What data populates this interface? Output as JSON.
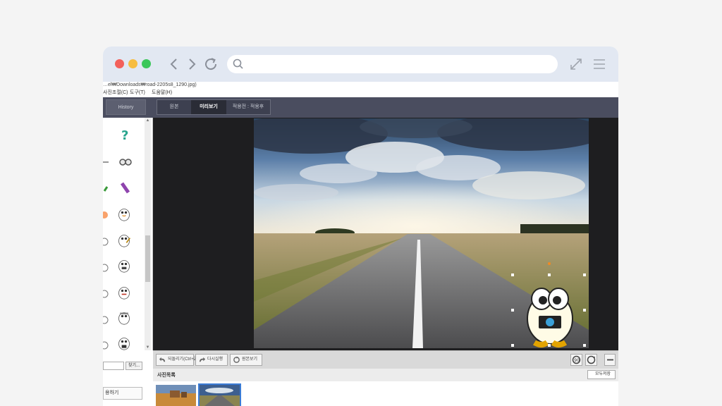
{
  "browser": {
    "url_placeholder": "",
    "url_value": "",
    "colors": {
      "close": "#f3605a",
      "minimize": "#f7bd40",
      "maximize": "#3bc75a",
      "chrome_bg": "#e2e8f2"
    },
    "icons": [
      "back-icon",
      "forward-icon",
      "reload-icon",
      "search-icon",
      "expand-icon",
      "menu-icon"
    ]
  },
  "app": {
    "path_text": "…el₩Downloads₩road-2205s8_1290.jpg)",
    "menu": [
      "사진조절(C)",
      "도구(T)",
      "도움말(H)"
    ],
    "history_label": "History",
    "tabs": [
      {
        "label": "원본",
        "active": false
      },
      {
        "label": "미리보기",
        "active": true
      },
      {
        "label": "적용전 : 적용후",
        "active": false
      }
    ],
    "find_label": "찾기...",
    "left_button_label": "용하기",
    "bottom_buttons": [
      {
        "label": "되돌리기(Ctrl+Z)",
        "icon": "undo-icon"
      },
      {
        "label": "다시실행",
        "icon": "redo-icon"
      },
      {
        "label": "원본보기",
        "icon": "reset-icon"
      }
    ],
    "photo_list_title": "사진목록",
    "save_all_label": "모두저장",
    "accent_color": "#f08a24",
    "thumbnails": [
      {
        "subject": "desert-village",
        "selected": false
      },
      {
        "subject": "road-landscape",
        "selected": true
      }
    ]
  }
}
